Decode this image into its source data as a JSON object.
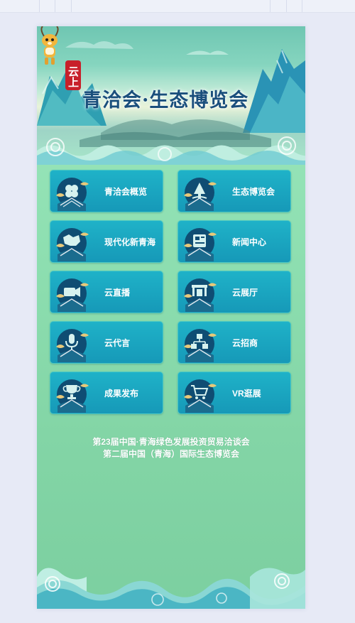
{
  "banner": {
    "seal_text": "云上",
    "title": "青洽会·生态博览会"
  },
  "menu": [
    {
      "label": "青洽会概览",
      "icon": "clover-icon"
    },
    {
      "label": "生态博览会",
      "icon": "tree-icon"
    },
    {
      "label": "现代化新青海",
      "icon": "map-icon"
    },
    {
      "label": "新闻中心",
      "icon": "newspaper-icon"
    },
    {
      "label": "云直播",
      "icon": "video-camera-icon"
    },
    {
      "label": "云展厅",
      "icon": "hall-icon"
    },
    {
      "label": "云代言",
      "icon": "microphone-icon"
    },
    {
      "label": "云招商",
      "icon": "network-icon"
    },
    {
      "label": "成果发布",
      "icon": "trophy-icon"
    },
    {
      "label": "VR逛展",
      "icon": "cart-icon"
    }
  ],
  "caption": {
    "line1": "第23届中国·青海绿色发展投资贸易洽谈会",
    "line2": "第二届中国（青海）国际生态博览会"
  },
  "colors": {
    "page_bg": "#e7eaf6",
    "tile": "#1fa8c4",
    "title": "#1a4f7c",
    "seal": "#c8202a"
  }
}
